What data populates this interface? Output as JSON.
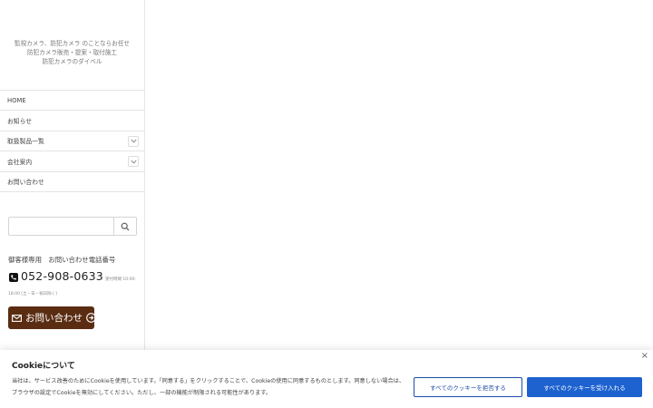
{
  "site": {
    "tagline_lines": [
      "監視カメラ、防犯カメラ のことならお任せ",
      "防犯カメラ販売・提案・取付施工",
      "防犯カメラのダイベル"
    ]
  },
  "nav": {
    "items": [
      {
        "label": "HOME"
      },
      {
        "label": "お知らせ"
      },
      {
        "label": "取扱製品一覧"
      },
      {
        "label": "会社案内"
      },
      {
        "label": "お問い合わせ"
      }
    ]
  },
  "search": {
    "placeholder": "",
    "icon": "search-icon"
  },
  "contact": {
    "heading": "御客様専用　お問い合わせ電話番号",
    "phone": "052-908-0633",
    "hours_part1": "受付時間 10:00-",
    "hours_part2": "18:00 [土・日・祝日除く]",
    "button_label": "お問い合わせ",
    "button_color": "#5a2d12"
  },
  "cookie": {
    "title": "Cookieについて",
    "text": "当社は、サービス改善のためにCookieを使用しています。「同意する」をクリックすることで、Cookieの使用に同意するものとします。同意しない場合は、ブラウザの設定でCookieを無効にしてください。ただし、一部の機能が制限される可能性があります。",
    "reject_label": "すべてのクッキーを拒否する",
    "accept_label": "すべてのクッキーを受け入れる",
    "close_label": "×",
    "accent_color": "#1e62d0"
  }
}
